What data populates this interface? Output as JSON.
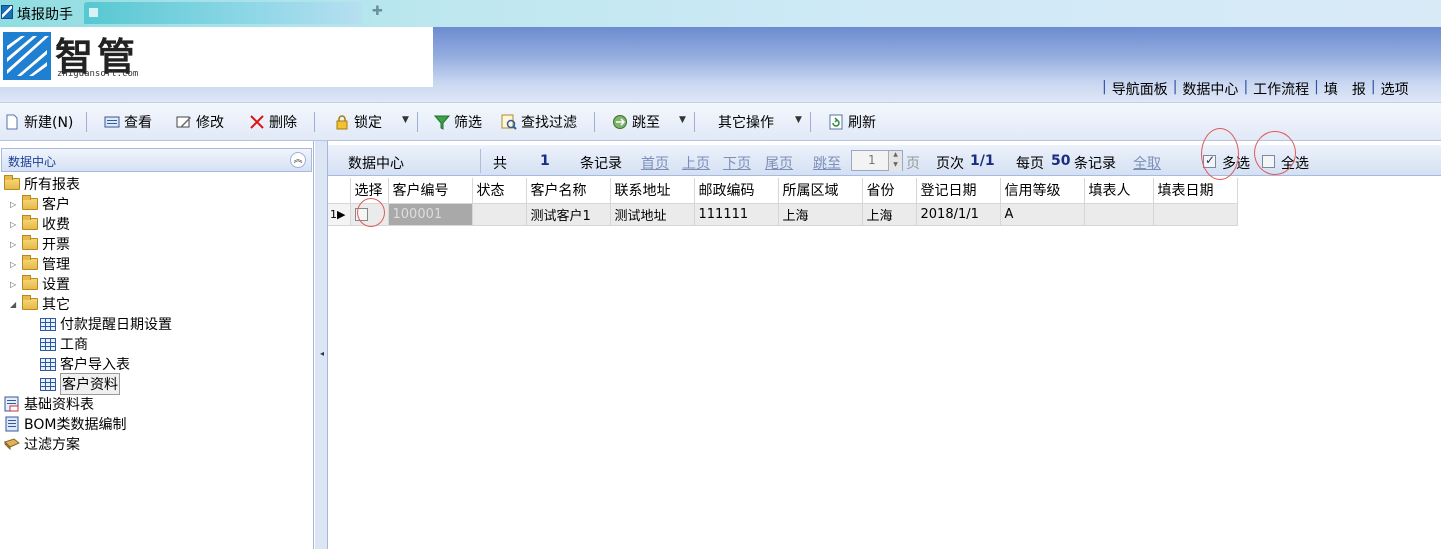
{
  "window": {
    "title": "填报助手"
  },
  "header": {
    "logo_cn": "智管",
    "logo_en": "zhiguansoft.com",
    "nav": [
      "导航面板",
      "数据中心",
      "工作流程",
      "填　报",
      "选项"
    ]
  },
  "toolbar": {
    "new_label": "新建(N)",
    "view_label": "查看",
    "edit_label": "修改",
    "delete_label": "删除",
    "lock_label": "锁定",
    "filter_label": "筛选",
    "search_filter_label": "查找过滤",
    "jump_label": "跳至",
    "other_ops_label": "其它操作",
    "refresh_label": "刷新"
  },
  "left_panel": {
    "title": "数据中心",
    "root": "所有报表",
    "folders": [
      "客户",
      "收费",
      "开票",
      "管理",
      "设置",
      "其它"
    ],
    "other_children": [
      "付款提醒日期设置",
      "工商",
      "客户导入表",
      "客户资料"
    ],
    "bottom_items": [
      "基础资料表",
      "BOM类数据编制",
      "过滤方案"
    ]
  },
  "data_header": {
    "title": "数据中心",
    "total_prefix": "共",
    "total_count": "1",
    "total_suffix": "条记录",
    "first": "首页",
    "prev": "上页",
    "next": "下页",
    "last": "尾页",
    "jump": "跳至",
    "page_input": "1",
    "page_unit": "页",
    "page_label": "页次",
    "page_value": "1/1",
    "per_page_label": "每页",
    "per_page_value": "50",
    "per_page_suffix": "条记录",
    "cancel_all": "全取",
    "multi_select": "多选",
    "multi_select_checked": true,
    "select_all": "全选",
    "select_all_checked": false
  },
  "table": {
    "columns": [
      "选择",
      "客户编号",
      "状态",
      "客户名称",
      "联系地址",
      "邮政编码",
      "所属区域",
      "省份",
      "登记日期",
      "信用等级",
      "填表人",
      "填表日期"
    ],
    "rows": [
      {
        "row_header": "1",
        "selected": false,
        "code": "100001",
        "status": "",
        "name": "测试客户1",
        "address": "测试地址",
        "postcode": "111111",
        "region": "上海",
        "province": "上海",
        "reg_date": "2018/1/1",
        "credit": "A",
        "filler": "",
        "fill_date": ""
      }
    ]
  },
  "colors": {
    "header_blue": "#6d8bd0",
    "link_gray": "#7d8fb8",
    "annotation_ring": "#e05a5a"
  }
}
